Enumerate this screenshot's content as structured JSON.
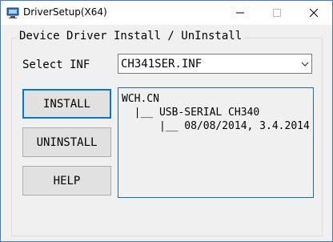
{
  "window": {
    "title": "DriverSetup(X64)",
    "controls": {
      "minimize_icon": "minimize-icon",
      "maximize_icon": "maximize-icon",
      "close_icon": "close-icon"
    }
  },
  "group": {
    "title": "Device Driver Install / UnInstall"
  },
  "inf": {
    "label": "Select INF",
    "selected": "CH341SER.INF"
  },
  "buttons": {
    "install": "INSTALL",
    "uninstall": "UNINSTALL",
    "help": "HELP"
  },
  "info": {
    "lines": [
      "WCH.CN",
      "  |__ USB-SERIAL CH340",
      "      |__ 08/08/2014, 3.4.2014"
    ]
  },
  "colors": {
    "accent": "#0078d7",
    "info_border": "#1f6bad",
    "background": "#f0f0f0"
  }
}
